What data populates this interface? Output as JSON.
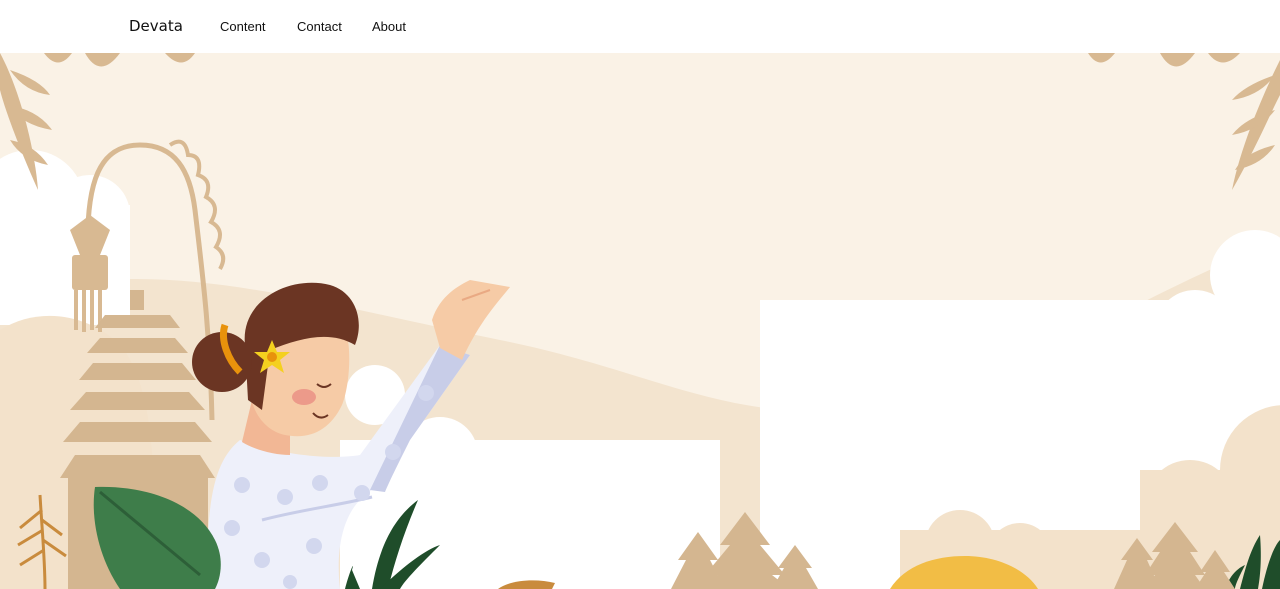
{
  "navbar": {
    "brand": "Devata",
    "links": [
      {
        "label": "Content"
      },
      {
        "label": "Contact"
      },
      {
        "label": "About"
      }
    ]
  },
  "hero": {
    "illustration": "balinese-woman-praying",
    "colors": {
      "sky": "#faf2e6",
      "hill": "#f3e4cf",
      "cloud": "#ffffff",
      "leaf_tan": "#d8b992",
      "temple": "#d4b690",
      "hair": "#6b3523",
      "skin": "#f6cba6",
      "dress": "#eef0fa",
      "dress_shadow": "#c8cde8",
      "flower": "#f4d01f",
      "leaf_green": "#3e7d4a",
      "sun": "#f2bd45"
    }
  }
}
